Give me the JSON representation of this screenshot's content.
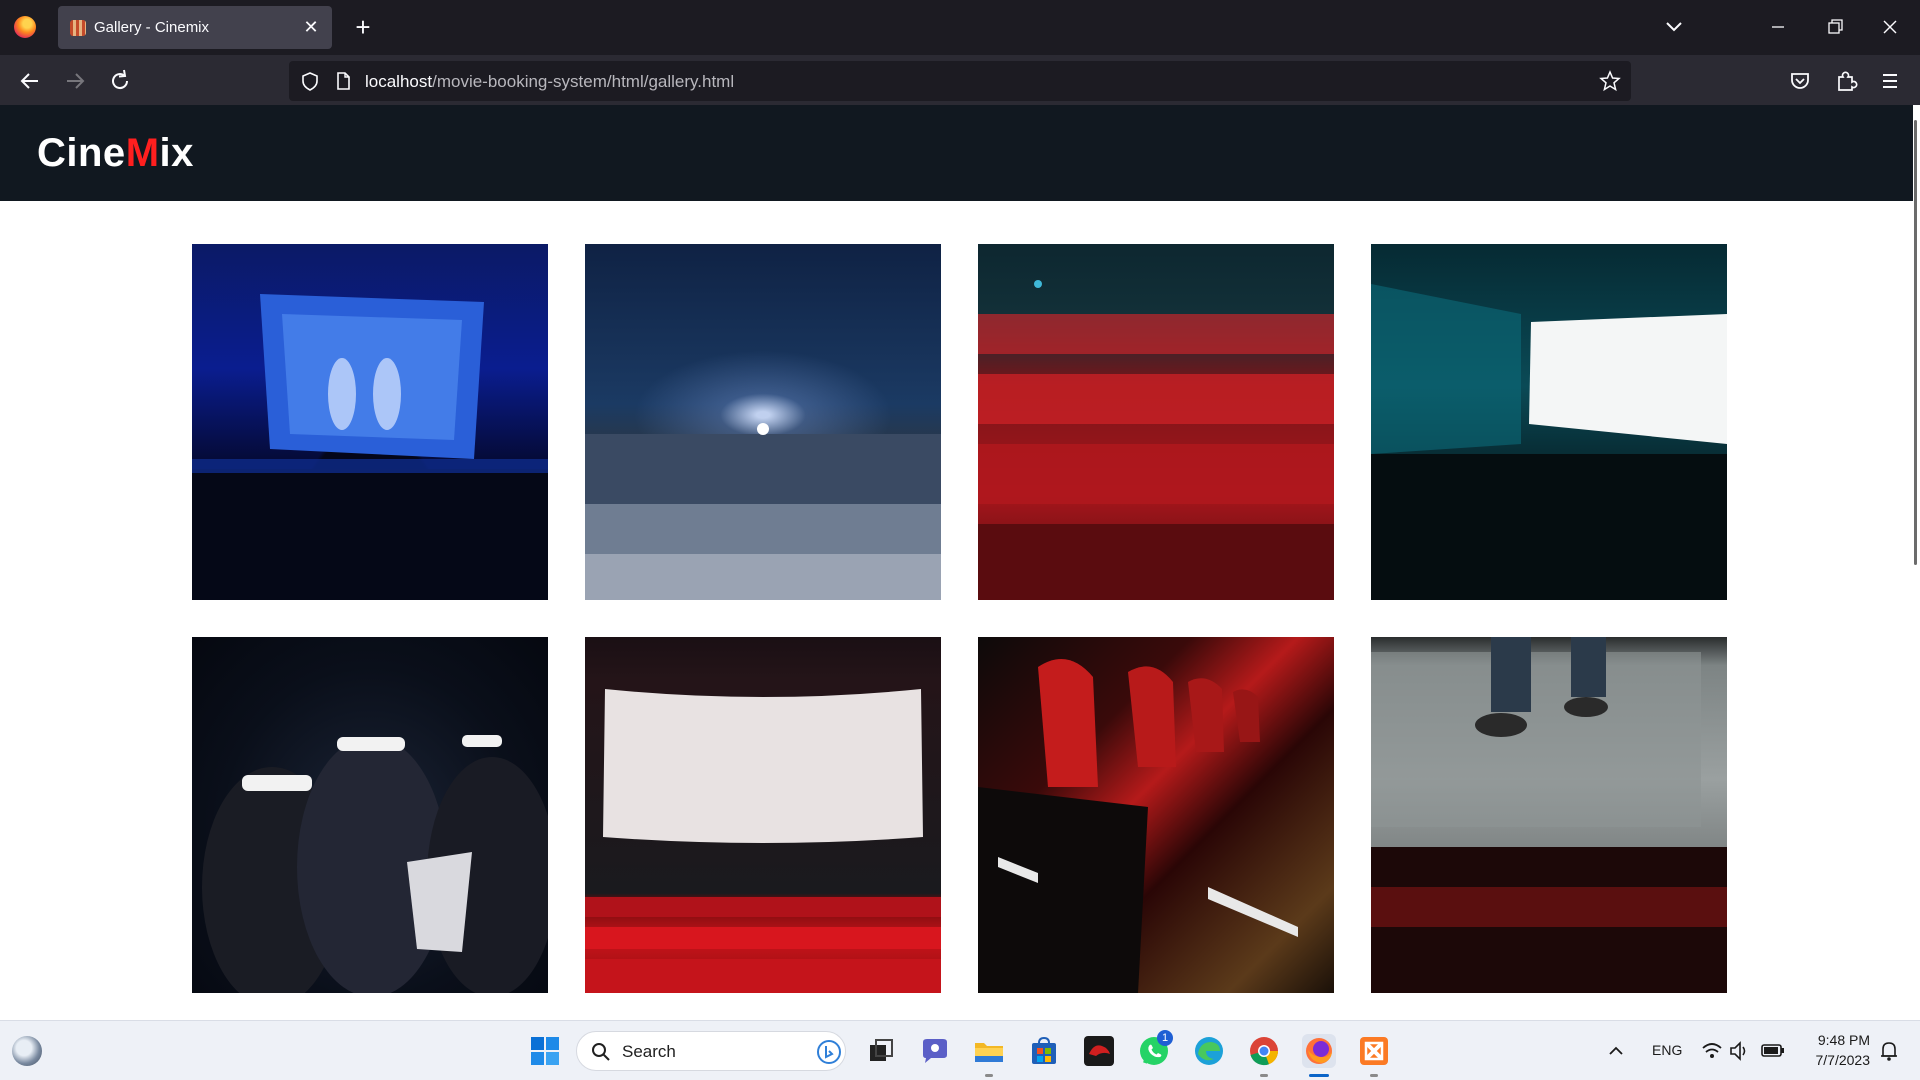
{
  "browser": {
    "tab_title": "Gallery - Cinemix",
    "tab_close": "✕",
    "new_tab": "+",
    "url_host": "localhost",
    "url_path": "/movie-booking-system/html/gallery.html"
  },
  "site": {
    "logo_part1": "Cine",
    "logo_accent": "M",
    "logo_part2": "ix",
    "accent_color": "#ff1f1f",
    "header_color": "#111820"
  },
  "gallery": {
    "images": [
      {
        "subject": "theater-stage-astronauts"
      },
      {
        "subject": "crowded-auditorium-projector"
      },
      {
        "subject": "audience-red-seats"
      },
      {
        "subject": "blank-screen-teal-hall"
      },
      {
        "subject": "viewers-3d-glasses-popcorn"
      },
      {
        "subject": "empty-screen-red-rows"
      },
      {
        "subject": "red-seat-row-closeup"
      },
      {
        "subject": "screen-feet-on-pavement"
      }
    ]
  },
  "taskbar": {
    "search_label": "Search",
    "whatsapp_badge": "1",
    "language": "ENG",
    "time": "9:48 PM",
    "date": "7/7/2023"
  }
}
